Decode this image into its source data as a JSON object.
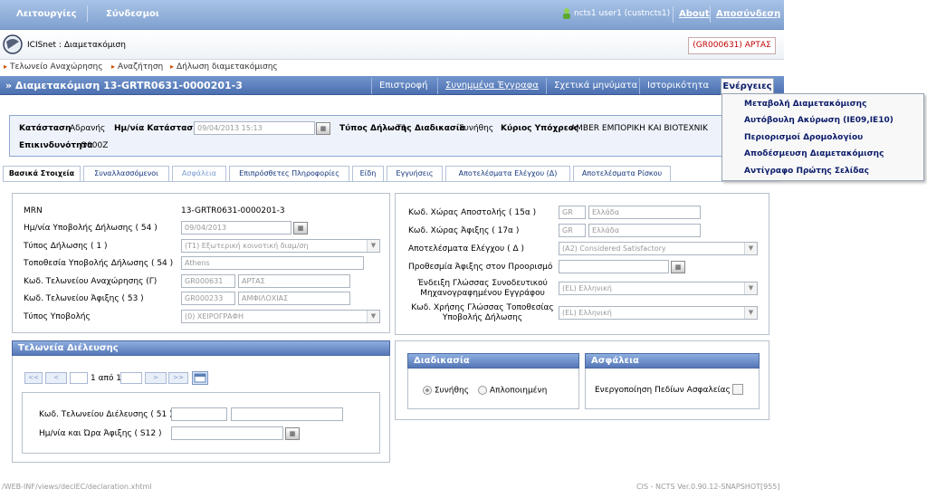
{
  "topbar": {
    "menu_operations": "Λειτουργίες",
    "menu_links": "Σύνδεσμοι",
    "user": "ncts1 user1 (custncts1)",
    "about": "About",
    "logout": "Αποσύνδεση"
  },
  "header": {
    "app_name": "ICISnet : Διαμετακόμιση",
    "office_badge": "(GR000631) ΑΡΤΑΣ"
  },
  "breadcrumb": [
    "Τελωνείο Αναχώρησης",
    "Αναζήτηση",
    "Δήλωση διαμετακόμισης"
  ],
  "titlebar": {
    "title": "» Διαμετακόμιση 13-GRTR0631-0000201-3",
    "buttons": [
      "Επιστροφή",
      "Συνημμένα Έγγραφα",
      "Σχετικά μηνύματα",
      "Ιστορικότητα",
      "Ενέργειες"
    ]
  },
  "actions_menu": [
    "Μεταβολή Διαμετακόμισης",
    "Αυτόβουλη Ακύρωση (IE09,IE10)",
    "Περιορισμοί Δρομολογίου",
    "Αποδέσμευση Διαμετακόμισης",
    "Αντίγραφο Πρώτης Σελίδας"
  ],
  "status": {
    "state_label": "Κατάσταση",
    "state_value": "Αδρανής",
    "state_date_label": "Ημ/νία Κατάστασης",
    "state_date_value": "09/04/2013 15:13",
    "decl_type_label": "Τύπος Δήλωσης",
    "decl_type_value": "T1",
    "procedure_label": "Διαδικασία",
    "procedure_value": "Συνήθης",
    "principal_label": "Κύριος Υπόχρεος",
    "principal_value": "AMBER ΕΜΠΟΡΙΚΗ ΚΑΙ ΒΙΟΤΕΧΝΙΚ",
    "risk_label": "Επικινδυνότητα",
    "risk_value": "O000Z"
  },
  "tabs": [
    "Βασικά Στοιχεία",
    "Συναλλασσόμενοι",
    "Ασφάλεια",
    "Επιπρόσθετες Πληροφορίες",
    "Είδη",
    "Εγγυήσεις",
    "Αποτελέσματα Ελέγχου (Δ)",
    "Αποτελέσματα Ρίσκου"
  ],
  "left_panel": {
    "mrn_label": "MRN",
    "mrn_value": "13-GRTR0631-0000201-3",
    "submit_date_label": "Ημ/νία Υποβολής Δήλωσης ( 54 )",
    "submit_date_value": "09/04/2013",
    "decl_type_label": "Τύπος Δήλωσης ( 1 )",
    "decl_type_value": "(T1) Εξωτερική κοινοτική διαμ/ση",
    "place_label": "Τοποθεσία Υποβολής Δήλωσης ( 54 )",
    "place_value": "Athens",
    "dep_office_label": "Κωδ. Τελωνείου Αναχώρησης (Γ)",
    "dep_office_code": "GR000631",
    "dep_office_name": "ΑΡΤΑΣ",
    "dest_office_label": "Κωδ. Τελωνείου Άφιξης ( 53 )",
    "dest_office_code": "GR000233",
    "dest_office_name": "ΑΜΦΙΛΟΧΙΑΣ",
    "submit_type_label": "Τύπος Υποβολής",
    "submit_type_value": "(0) ΧΕΙΡΟΓΡΑΦΗ"
  },
  "right_panel": {
    "dispatch_country_label": "Κωδ. Χώρας Αποστολής ( 15α )",
    "dispatch_country_code": "GR",
    "dispatch_country_name": "Ελλάδα",
    "arrival_country_label": "Κωδ. Χώρας Άφιξης ( 17α )",
    "arrival_country_code": "GR",
    "arrival_country_name": "Ελλάδα",
    "control_result_label": "Αποτελέσματα Ελέγχου ( Δ )",
    "control_result_value": "(A2) Considered Satisfactory",
    "deadline_label": "Προθεσμία Άφιξης στον Προορισμό",
    "doc_lang_label_1": "Ένδειξη Γλώσσας Συνοδευτικού",
    "doc_lang_label_2": "Μηχανογραφημένου Εγγράφου",
    "doc_lang_value": "(EL) Ελληνική",
    "decl_lang_label_1": "Κωδ. Χρήσης Γλώσσας Τοποθεσίας",
    "decl_lang_label_2": "Υποβολής Δήλωσης",
    "decl_lang_value": "(EL) Ελληνική"
  },
  "transit": {
    "header": "Τελωνεία Διέλευσης",
    "pager_first": "<<",
    "pager_prev": "<",
    "pager_text": "1 από 1",
    "pager_next": ">",
    "pager_last": ">>",
    "office_label": "Κωδ. Τελωνείου Διέλευσης ( 51 )",
    "arrival_label": "Ημ/νία και Ώρα Άφιξης ( S12 )"
  },
  "procedure": {
    "header": "Διαδικασία",
    "option_normal": "Συνήθης",
    "option_simplified": "Απλοποιημένη",
    "selected": "Συνήθης"
  },
  "security": {
    "header": "Ασφάλεια",
    "enable_label": "Ενεργοποίηση Πεδίων Ασφαλείας"
  },
  "footer": {
    "path": "/WEB-INF/views/declEC/declaration.xhtml",
    "version": "CIS - NCTS Ver.0.90.12-SNAPSHOT[955]"
  },
  "colors": {
    "topbar": "#7fa0d0",
    "titlebar": "#4b6fb0",
    "menu_text": "#0b1c6a",
    "badge_text": "#c00000"
  }
}
